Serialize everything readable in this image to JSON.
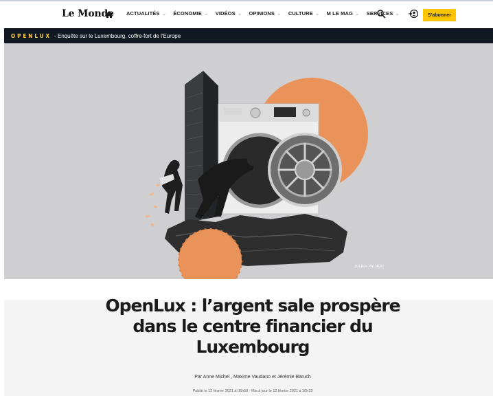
{
  "nav": {
    "logo": "Le Monde",
    "items": [
      {
        "label": "ACTUALITÉS",
        "has_menu": true
      },
      {
        "label": "ÉCONOMIE",
        "has_menu": true
      },
      {
        "label": "VIDÉOS",
        "has_menu": true
      },
      {
        "label": "OPINIONS",
        "has_menu": true
      },
      {
        "label": "CULTURE",
        "has_menu": true
      },
      {
        "label": "M LE MAG",
        "has_menu": true
      },
      {
        "label": "SERVICES",
        "has_menu": true
      }
    ],
    "chevron": "⌄",
    "subscribe_label": "S'abonner",
    "icons": [
      "home-icon",
      "search-icon",
      "login-icon"
    ]
  },
  "banner": {
    "tag": "OPENLUX",
    "text": "- Enquête sur le Luxembourg, coffre-fort de l'Europe"
  },
  "hero": {
    "credit": "JULIEN PACAUD"
  },
  "article": {
    "headline": "OpenLux : l’argent sale prospère dans le centre financier du Luxembourg",
    "byline": "Par Anne Michel , Maxime Vaudano et Jérémie Baruch",
    "dates": "Publié le 12 février 2021 à 05h58 - Mis à jour le 12 février 2021 à 10h19"
  },
  "colors": {
    "banner_bg": "#111822",
    "banner_tag": "#ffd34d",
    "subscribe_bg": "#ffc600",
    "hero_bg": "#cfcfd2",
    "orange": "#e9935a"
  }
}
